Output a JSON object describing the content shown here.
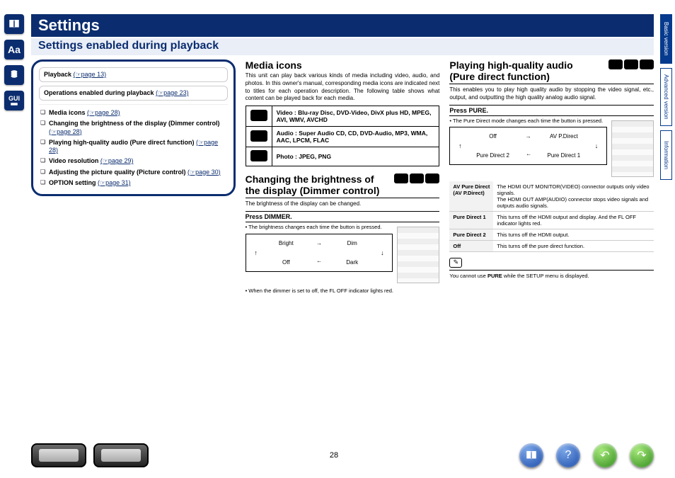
{
  "page_title": "Settings",
  "page_subtitle": "Settings enabled during playback",
  "page_number": "28",
  "right_tabs": [
    {
      "label": "Basic version",
      "active": true
    },
    {
      "label": "Advanced version",
      "active": false
    },
    {
      "label": "Information",
      "active": false
    }
  ],
  "nav_card": {
    "playback_label": "Playback",
    "playback_ref": "(☞page 13)",
    "ops_label": "Operations enabled during playback",
    "ops_ref": "(☞page 23)",
    "items": [
      {
        "label": "Media icons",
        "ref": "(☞page 28)"
      },
      {
        "label": "Changing the brightness of the display (Dimmer control)",
        "ref": "(☞page 28)"
      },
      {
        "label": "Playing high-quality audio (Pure direct function)",
        "ref": "(☞page 28)"
      },
      {
        "label": "Video resolution",
        "ref": "(☞page 29)"
      },
      {
        "label": "Adjusting the picture quality (Picture control)",
        "ref": "(☞page 30)"
      },
      {
        "label": "OPTION setting",
        "ref": "(☞page 31)"
      }
    ]
  },
  "media_icons": {
    "title": "Media icons",
    "desc": "This unit can play back various kinds of media including video, audio, and photos. In this owner's manual, corresponding media icons are indicated next to titles for each operation description. The following table shows what content can be played back for each media.",
    "rows": [
      {
        "type": "Video :",
        "formats": "Blu-ray Disc, DVD-Video, DivX plus HD, MPEG, AVI, WMV, AVCHD"
      },
      {
        "type": "Audio :",
        "formats": "Super Audio CD, CD, DVD-Audio, MP3, WMA, AAC, LPCM, FLAC"
      },
      {
        "type": "Photo :",
        "formats": "JPEG, PNG"
      }
    ]
  },
  "dimmer": {
    "title_l1": "Changing the brightness of",
    "title_l2": "the display (Dimmer control)",
    "desc": "The brightness of the display can be changed.",
    "press_label": "Press",
    "press_btn": "DIMMER.",
    "note": "The brightness changes each time the button is pressed.",
    "cycle": [
      "Bright",
      "Dim",
      "Off",
      "Dark"
    ],
    "footnote": "• When the dimmer is set to off, the FL OFF indicator lights red."
  },
  "pure_direct": {
    "title_l1": "Playing high-quality audio",
    "title_l2": "(Pure direct function)",
    "desc": "This enables you to play high quality audio by stopping the video signal, etc., output, and outputting the high quality analog audio signal.",
    "press_label": "Press",
    "press_btn": "PURE.",
    "note": "The Pure Direct mode changes each time the button is pressed.",
    "cycle": [
      "Off",
      "AV P.Direct",
      "Pure Direct 2",
      "Pure Direct 1"
    ],
    "modes": [
      {
        "name_l1": "AV Pure Direct",
        "name_l2": "(AV P.Direct)",
        "desc": "The HDMI OUT MONITOR(VIDEO) connector outputs only video signals.\nThe HDMI OUT AMP(AUDIO) connector stops video signals and outputs audio signals."
      },
      {
        "name_l1": "Pure Direct 1",
        "name_l2": "",
        "desc": "This turns off the HDMI output and display. And the FL OFF indicator lights red."
      },
      {
        "name_l1": "Pure Direct 2",
        "name_l2": "",
        "desc": "This turns off the HDMI output."
      },
      {
        "name_l1": "Off",
        "name_l2": "",
        "desc": "This turns off the pure direct function."
      }
    ],
    "warning_pre": "You cannot use ",
    "warning_bold": "PURE",
    "warning_post": " while the SETUP menu is displayed."
  }
}
